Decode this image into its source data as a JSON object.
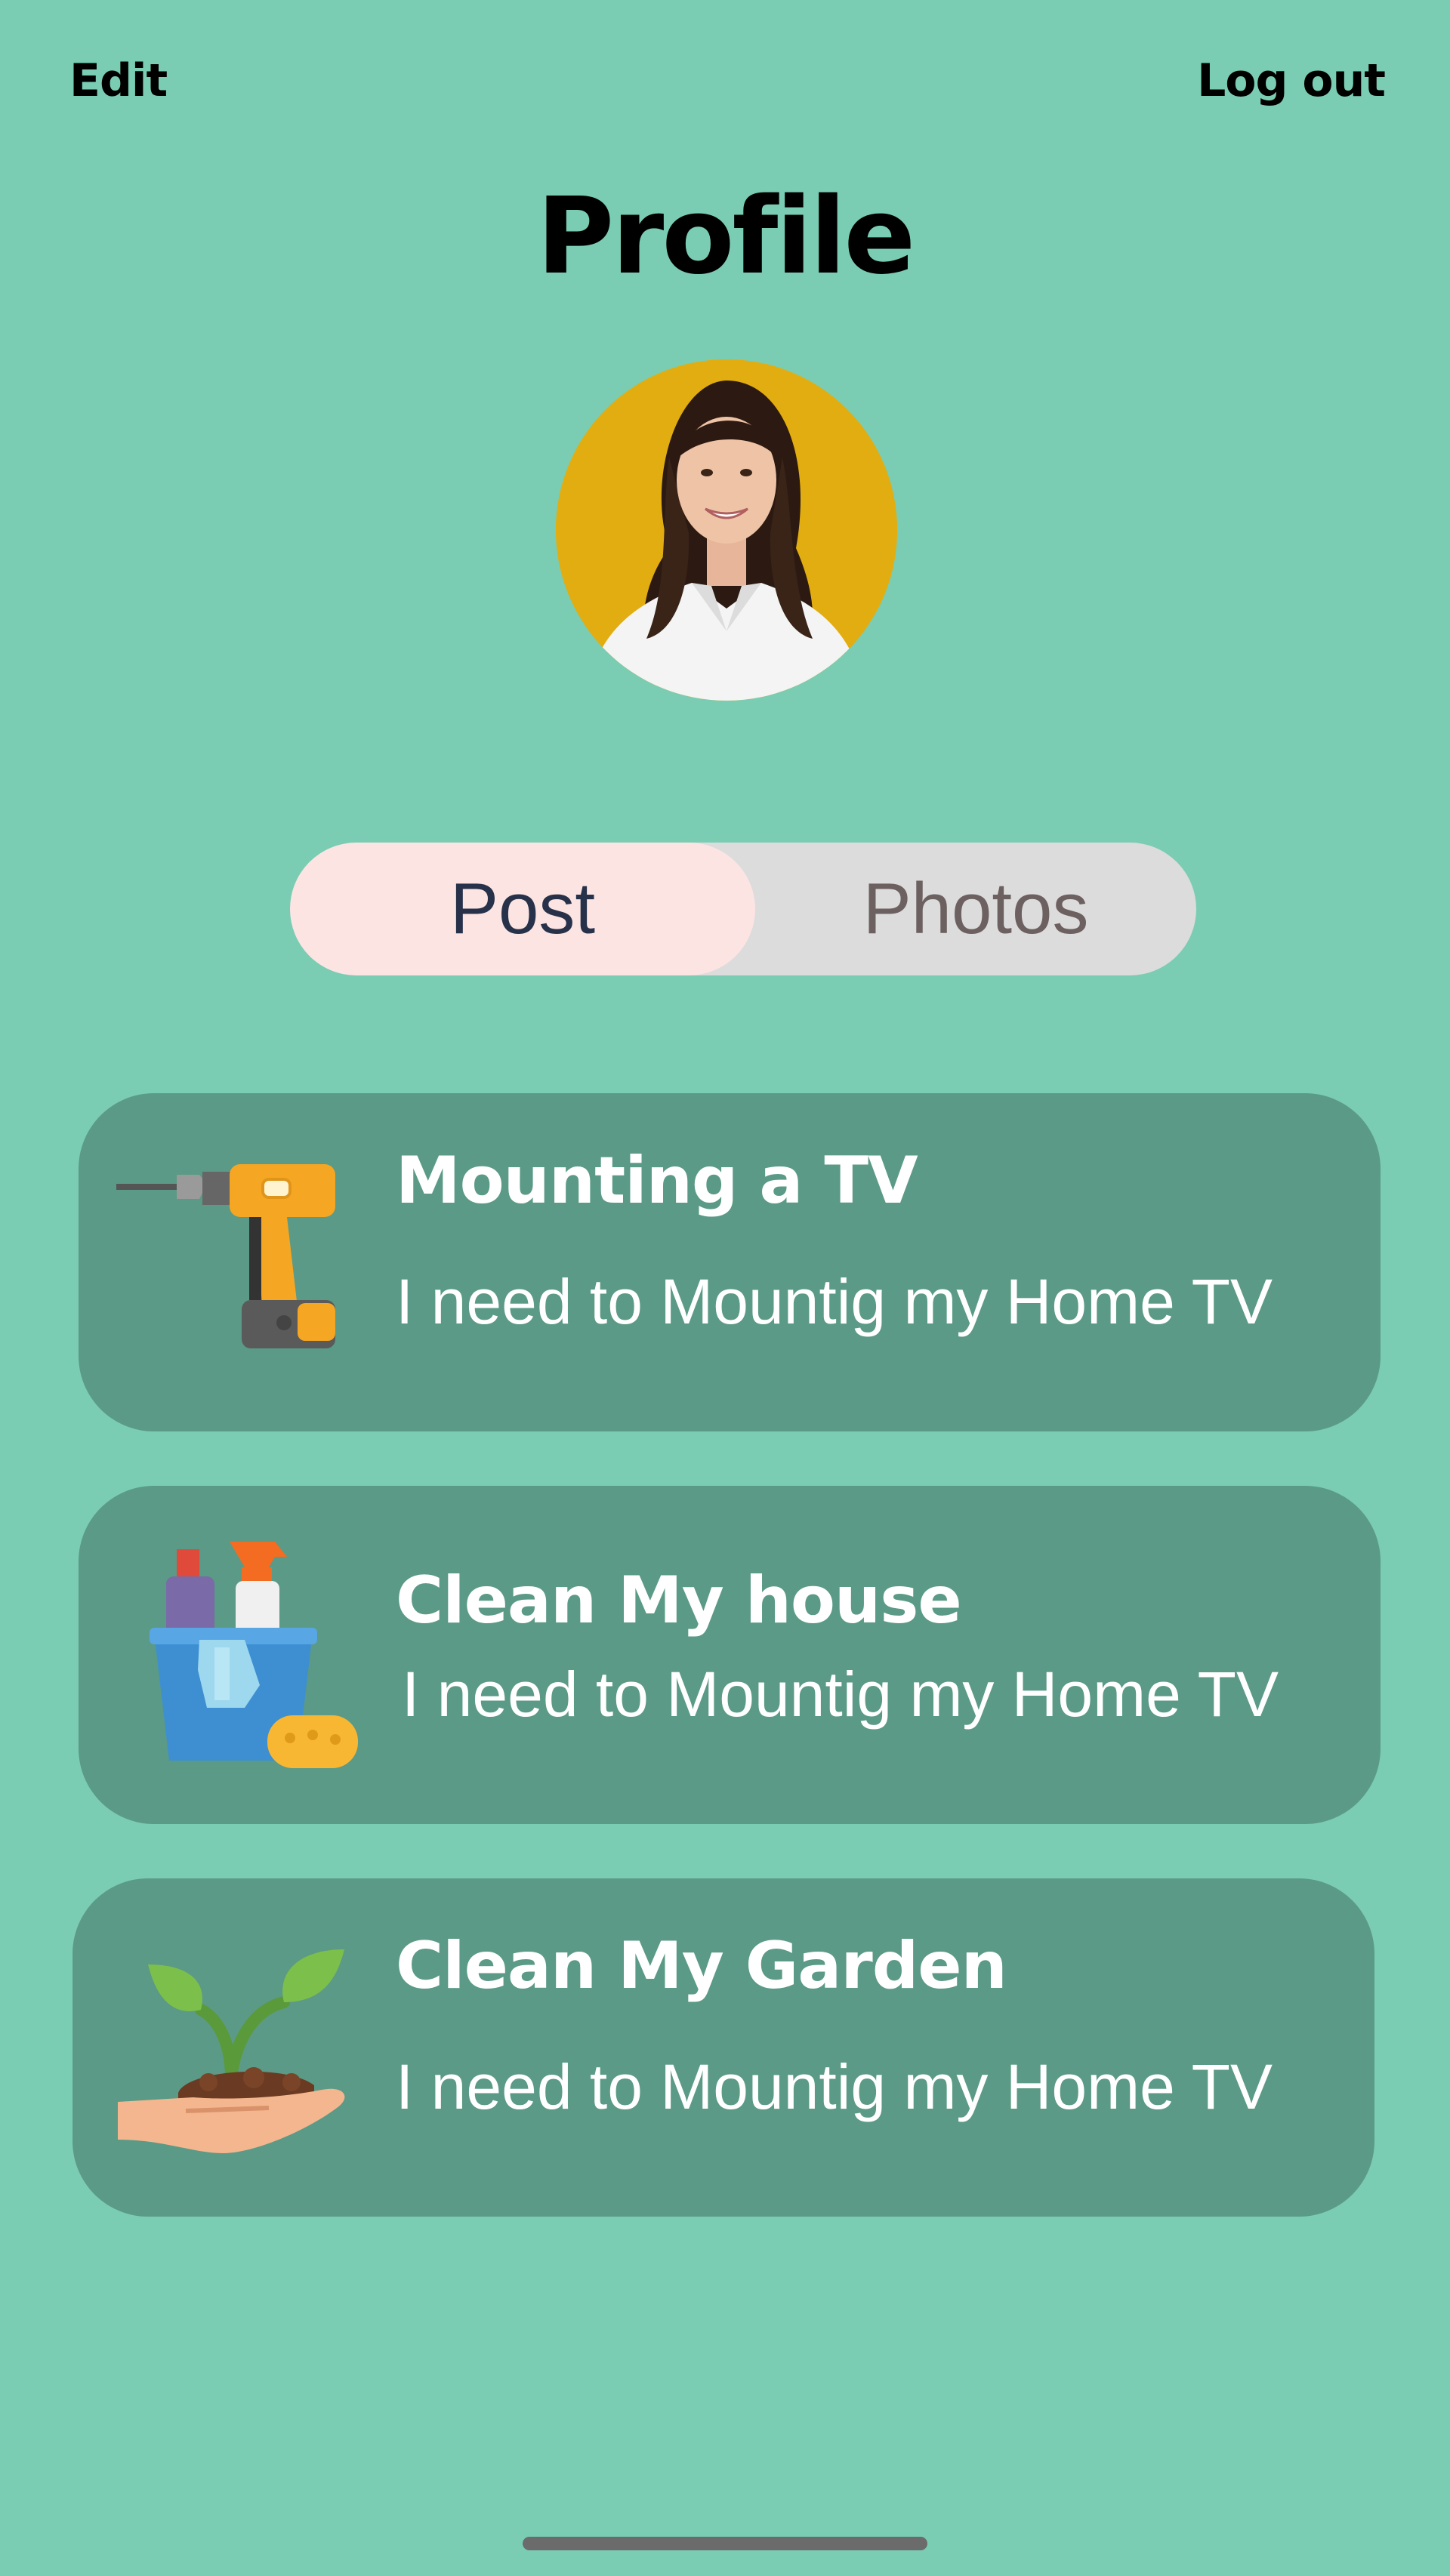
{
  "header": {
    "edit_label": "Edit",
    "logout_label": "Log out",
    "title": "Profile"
  },
  "tabs": [
    {
      "label": "Post",
      "active": true
    },
    {
      "label": "Photos",
      "active": false
    }
  ],
  "posts": [
    {
      "title": "Mounting a TV",
      "description": "I need to Mountig my Home TV",
      "icon": "drill-icon"
    },
    {
      "title": "Clean My house",
      "description": "I need to Mountig my Home TV",
      "icon": "cleaning-bucket-icon"
    },
    {
      "title": "Clean My Garden",
      "description": "I need to Mountig my Home TV",
      "icon": "plant-in-hand-icon"
    }
  ],
  "colors": {
    "background": "#7acdb3",
    "card": "#5b9a86",
    "tab_active": "#fce4e3",
    "tab_inactive": "#dcdcdc",
    "avatar_bg": "#e2ad10"
  }
}
